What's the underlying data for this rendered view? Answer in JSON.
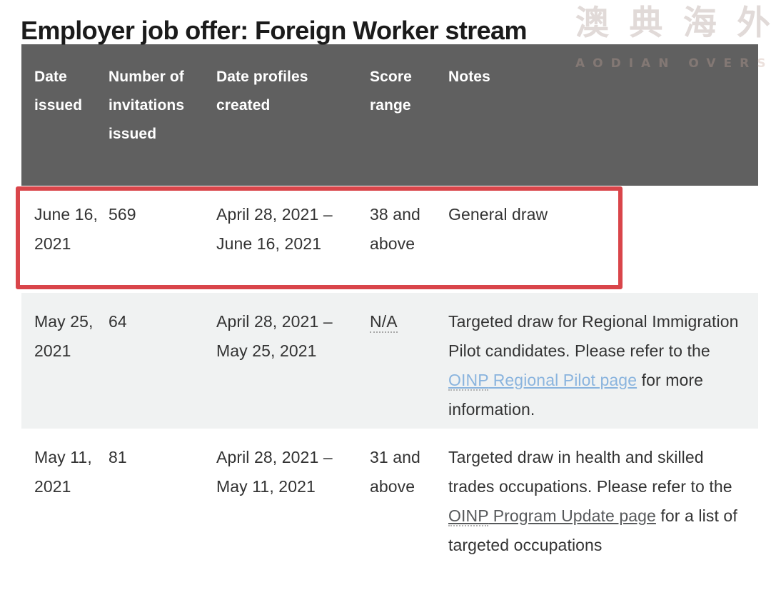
{
  "page_title": "Employer job offer: Foreign Worker stream",
  "watermark": {
    "text": "澳 典 海 外",
    "subtext": "AODIAN OVERSEAS"
  },
  "colors": {
    "header_background": "#606060",
    "header_text": "#ffffff",
    "body_text": "#333333",
    "shaded_row": "#f0f2f2",
    "highlight_border": "#d9454a",
    "link": "#8ab4de",
    "link_dark": "#57595b"
  },
  "table": {
    "columns": [
      {
        "key": "date_issued",
        "label": "Date issued"
      },
      {
        "key": "invitations",
        "label": "Number of invitations issued"
      },
      {
        "key": "profiles_created",
        "label": "Date profiles created"
      },
      {
        "key": "score_range",
        "label": "Score range"
      },
      {
        "key": "notes",
        "label": "Notes"
      }
    ],
    "rows": [
      {
        "date_issued": "June 16, 2021",
        "invitations": "569",
        "profiles_created": "April 28, 2021 – June 16, 2021",
        "score_range": "38 and above",
        "notes_plain": "General draw",
        "highlighted": true,
        "shaded": false
      },
      {
        "date_issued": "May 25, 2021",
        "invitations": "64",
        "profiles_created": "April 28, 2021 – May 25, 2021",
        "score_range": "N/A",
        "notes_before": "Targeted draw for Regional Immigration Pilot candidates. Please refer to the ",
        "notes_link_abbr": "OINP",
        "notes_link_rest": " Regional Pilot page",
        "notes_after": " for more information.",
        "highlighted": false,
        "shaded": true
      },
      {
        "date_issued": "May 11, 2021",
        "invitations": "81",
        "profiles_created": "April 28, 2021 – May 11, 2021",
        "score_range": "31 and above",
        "notes_before": "Targeted draw in health and skilled trades occupations. Please refer to the ",
        "notes_link_abbr": "OINP",
        "notes_link_rest": " Program Update page",
        "notes_after": " for a list of targeted occupations",
        "highlighted": false,
        "shaded": false
      }
    ]
  }
}
